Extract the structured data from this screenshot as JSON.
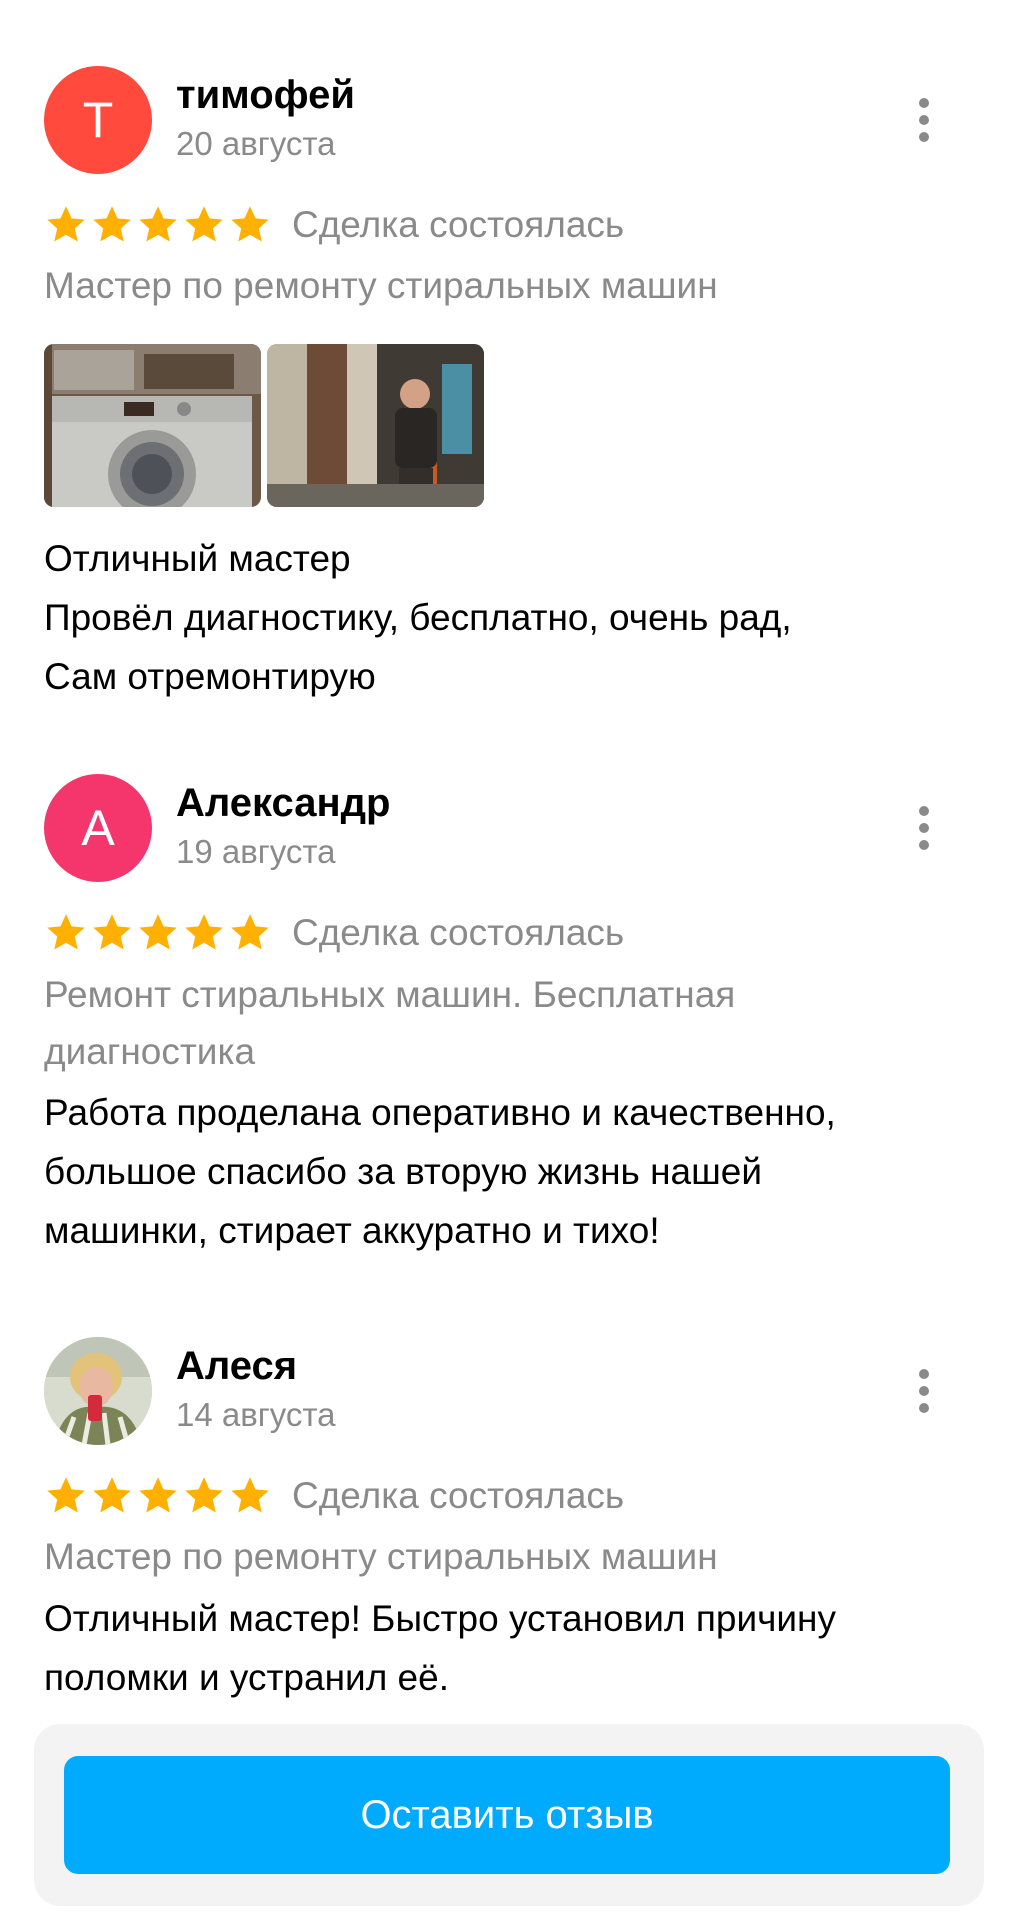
{
  "reviews": [
    {
      "author": "тимофей",
      "avatar_letter": "Т",
      "avatar_color": "#ff4a3d",
      "date": "20 августа",
      "rating": 5,
      "status": "Сделка состоялась",
      "service": "Мастер по ремонту стиральных машин",
      "photos": [
        "washing-machine-photo",
        "person-in-basement-photo"
      ],
      "text_lines": [
        "Отличный мастер",
        "Провёл диагностику, бесплатно, очень рад,",
        "Сам отремонтирую"
      ]
    },
    {
      "author": "Александр",
      "avatar_letter": "А",
      "avatar_color": "#f4366d",
      "date": "19 августа",
      "rating": 5,
      "status": "Сделка состоялась",
      "service": "Ремонт стиральных машин. Бесплатная диагностика",
      "text_lines": [
        "Работа проделана оперативно и качественно,",
        "большое спасибо за вторую жизнь нашей",
        "машинки, стирает аккуратно и тихо!"
      ]
    },
    {
      "author": "Алеся",
      "avatar_type": "photo",
      "date": "14 августа",
      "rating": 5,
      "status": "Сделка состоялась",
      "service": "Мастер по ремонту стиральных машин",
      "text_lines": [
        "Отличный мастер! Быстро установил причину",
        "поломки и устранил её."
      ]
    }
  ],
  "footer": {
    "button_label": "Оставить отзыв",
    "button_color": "#00abfe"
  },
  "colors": {
    "star": "#ffb000",
    "muted_text": "#8a8a8a"
  }
}
